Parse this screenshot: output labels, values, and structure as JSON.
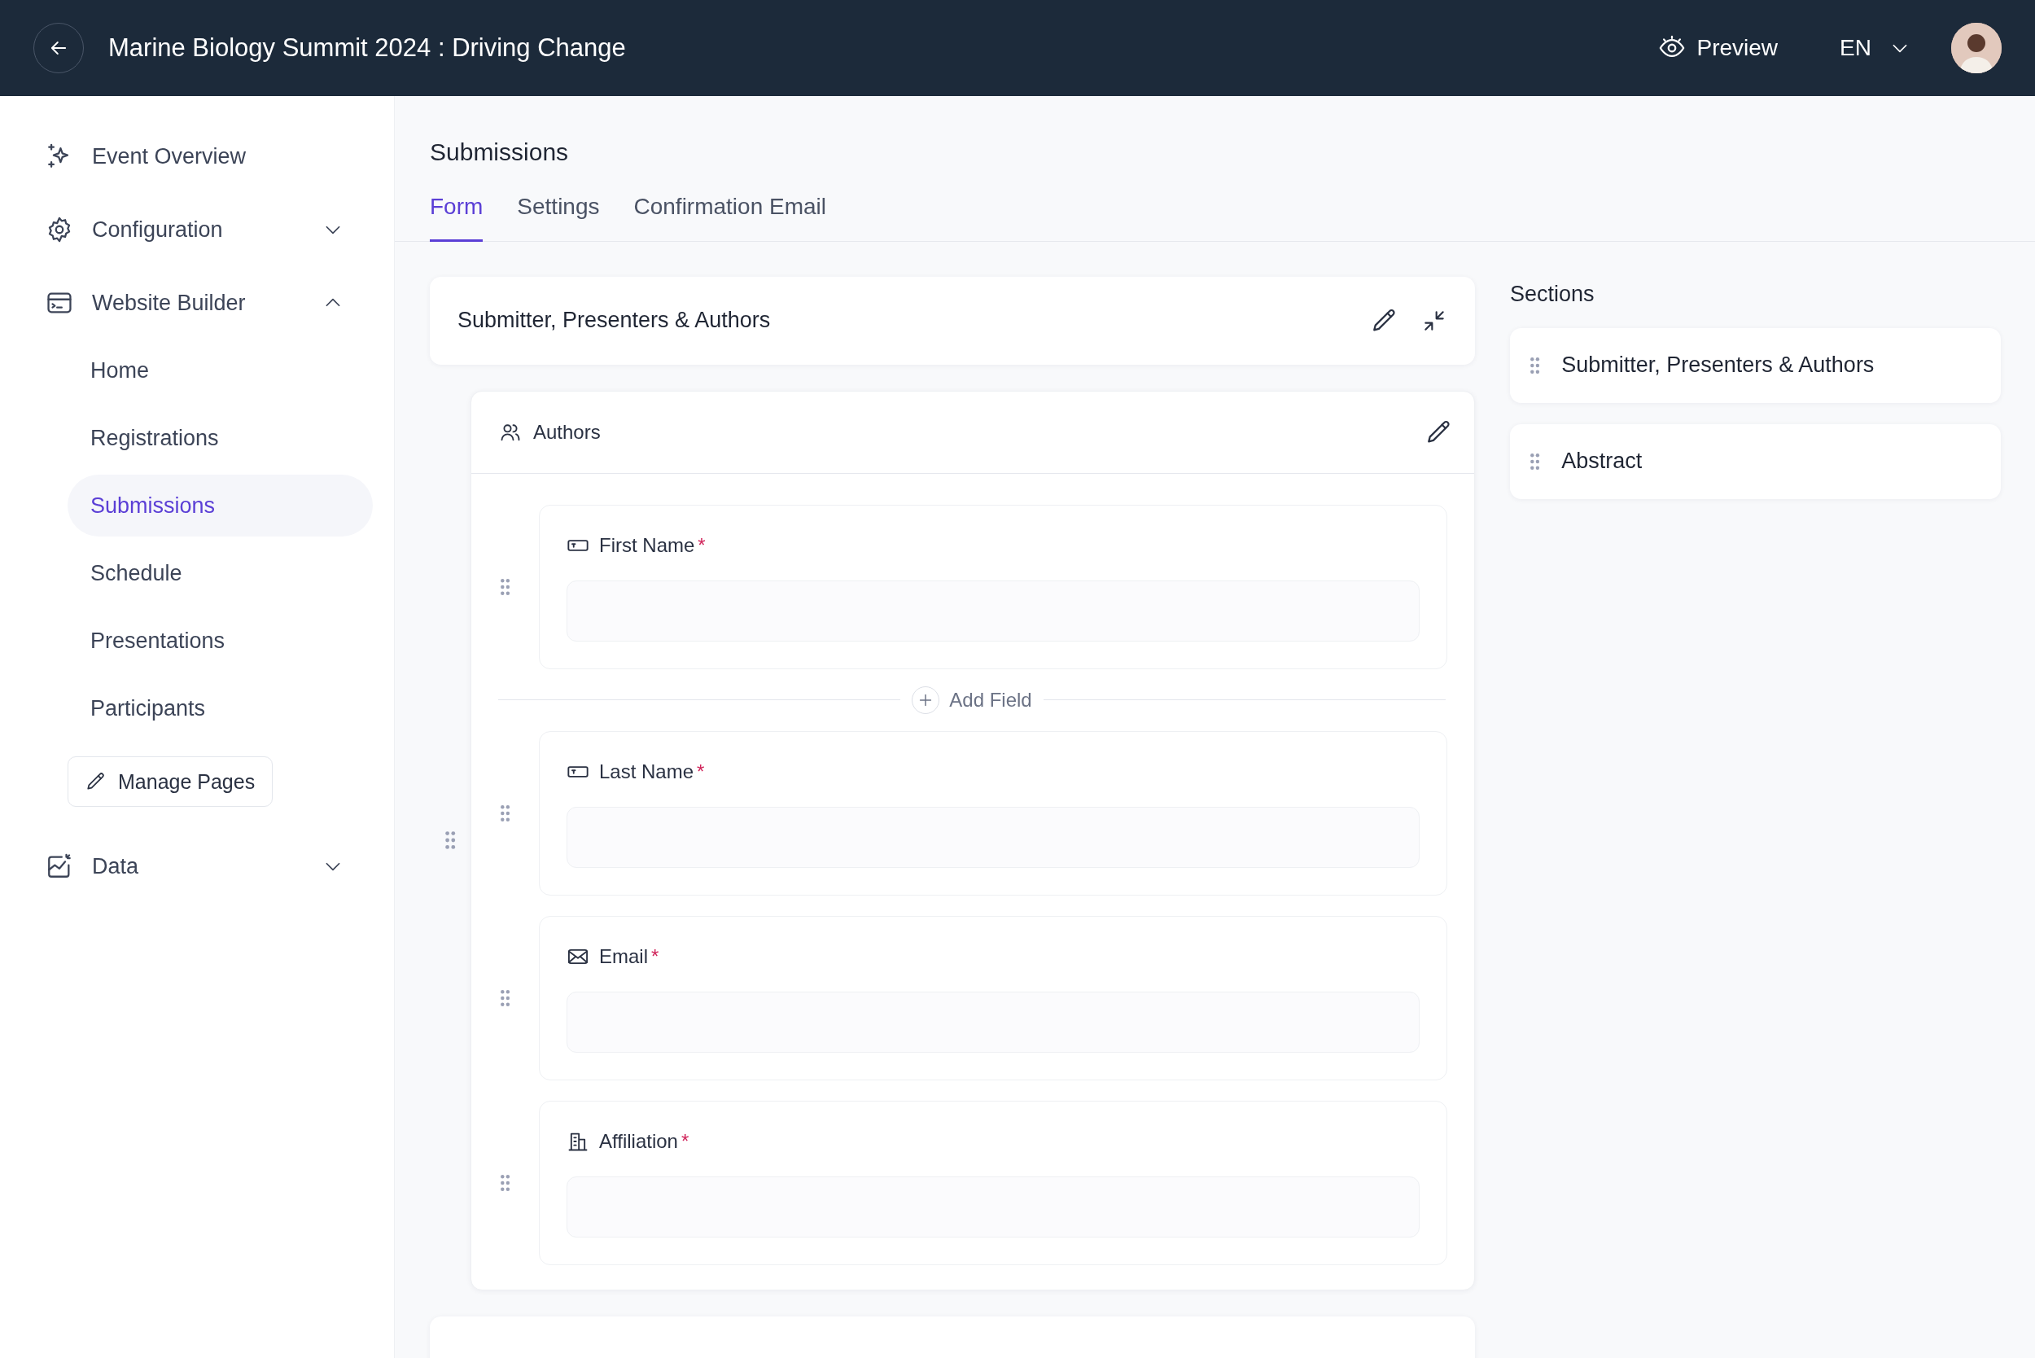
{
  "top_bar": {
    "title": "Marine Biology Summit 2024 : Driving Change",
    "preview": "Preview",
    "language": "EN"
  },
  "sidebar": {
    "items": [
      {
        "kind": "link",
        "label": "Event Overview"
      },
      {
        "kind": "group",
        "label": "Configuration",
        "expanded": false
      },
      {
        "kind": "group",
        "label": "Website Builder",
        "expanded": true,
        "children": [
          {
            "label": "Home",
            "selected": false
          },
          {
            "label": "Registrations",
            "selected": false
          },
          {
            "label": "Submissions",
            "selected": true
          },
          {
            "label": "Schedule",
            "selected": false
          },
          {
            "label": "Presentations",
            "selected": false
          },
          {
            "label": "Participants",
            "selected": false
          }
        ],
        "action": "Manage Pages"
      },
      {
        "kind": "group",
        "label": "Data",
        "expanded": false
      }
    ]
  },
  "page": {
    "heading": "Submissions",
    "tabs": [
      {
        "label": "Form",
        "selected": true
      },
      {
        "label": "Settings",
        "selected": false
      },
      {
        "label": "Confirmation Email",
        "selected": false
      }
    ]
  },
  "form": {
    "section_title": "Submitter, Presenters & Authors",
    "group": {
      "title": "Authors",
      "fields": [
        {
          "kind": "field",
          "label": "First Name",
          "required_mark": "*"
        },
        {
          "kind": "add",
          "label": "Add Field"
        },
        {
          "kind": "field",
          "label": "Last Name",
          "required_mark": "*"
        },
        {
          "kind": "field",
          "label": "Email",
          "required_mark": "*"
        },
        {
          "kind": "field",
          "label": "Affiliation",
          "required_mark": "*"
        }
      ]
    }
  },
  "sections_panel": {
    "title": "Sections",
    "items": [
      {
        "label": "Submitter, Presenters & Authors"
      },
      {
        "label": "Abstract"
      }
    ]
  }
}
